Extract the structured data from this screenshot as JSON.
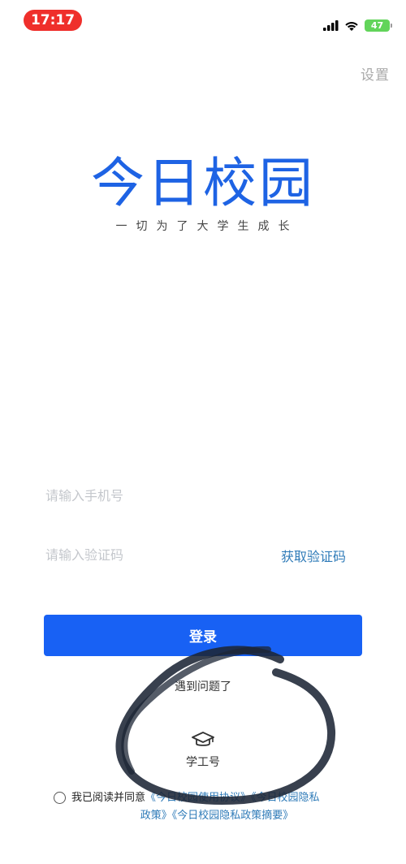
{
  "status_bar": {
    "time": "17:17",
    "battery": "47"
  },
  "header": {
    "settings_label": "设置"
  },
  "brand": {
    "logo_text": "今日校园",
    "slogan": "一切为了大学生成长"
  },
  "form": {
    "phone_placeholder": "请输入手机号",
    "code_placeholder": "请输入验证码",
    "get_code_label": "获取验证码",
    "login_label": "登录"
  },
  "help": {
    "problem_label": "遇到问题了"
  },
  "alt_login": {
    "label": "学工号",
    "icon": "graduation-cap-icon"
  },
  "agreement": {
    "prefix": "我已阅读并同意",
    "terms_link": "《今日校园使用协议》",
    "privacy_link_line1": "《今日校园隐私",
    "privacy_link_line2": "政策》",
    "summary_link": "《今日校园隐私政策摘要》"
  },
  "colors": {
    "brand_blue": "#1e63e4",
    "button_blue": "#1861f4",
    "link_blue": "#2f7bb8",
    "time_pill_red": "#ef2f2b",
    "battery_green": "#62d45a"
  }
}
